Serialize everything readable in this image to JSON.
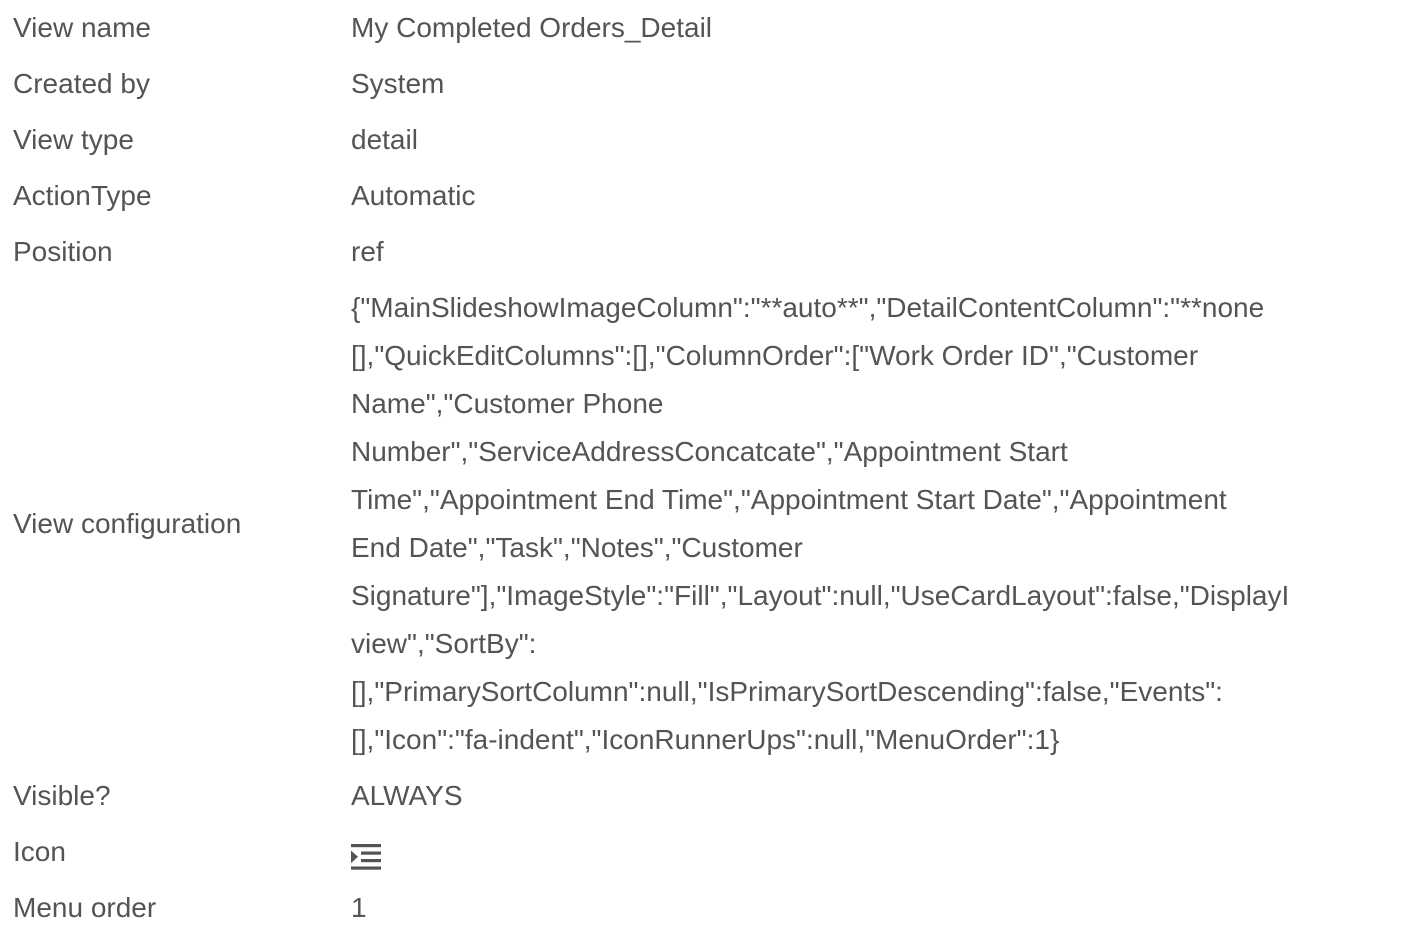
{
  "rows": {
    "view_name": {
      "label": "View name",
      "value": "My Completed Orders_Detail"
    },
    "created_by": {
      "label": "Created by",
      "value": "System"
    },
    "view_type": {
      "label": "View type",
      "value": "detail"
    },
    "action_type": {
      "label": "ActionType",
      "value": "Automatic"
    },
    "position": {
      "label": "Position",
      "value": "ref"
    },
    "view_configuration": {
      "label": "View configuration",
      "lines": [
        "{\"MainSlideshowImageColumn\":\"**auto**\",\"DetailContentColumn\":\"**none",
        "[],\"QuickEditColumns\":[],\"ColumnOrder\":[\"Work Order ID\",\"Customer",
        "Name\",\"Customer Phone",
        "Number\",\"ServiceAddressConcatcate\",\"Appointment Start",
        "Time\",\"Appointment End Time\",\"Appointment Start Date\",\"Appointment",
        "End Date\",\"Task\",\"Notes\",\"Customer",
        "Signature\"],\"ImageStyle\":\"Fill\",\"Layout\":null,\"UseCardLayout\":false,\"DisplayI",
        "view\",\"SortBy\":",
        "[],\"PrimarySortColumn\":null,\"IsPrimarySortDescending\":false,\"Events\":",
        "[],\"Icon\":\"fa-indent\",\"IconRunnerUps\":null,\"MenuOrder\":1}"
      ]
    },
    "visible": {
      "label": "Visible?",
      "value": "ALWAYS"
    },
    "icon": {
      "label": "Icon",
      "icon_name": "indent-icon"
    },
    "menu_order": {
      "label": "Menu order",
      "value": "1"
    }
  },
  "colors": {
    "text": "#545454",
    "background": "#ffffff"
  }
}
